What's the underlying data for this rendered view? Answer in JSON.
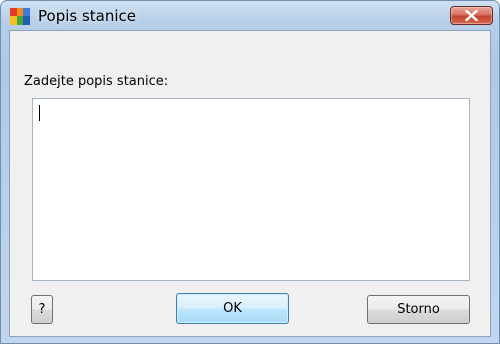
{
  "window": {
    "title": "Popis stanice",
    "app_icon": "avg-logo-icon",
    "close_icon": "close-icon"
  },
  "form": {
    "prompt_label": "Zadejte popis stanice:",
    "description_value": "",
    "description_placeholder": ""
  },
  "buttons": {
    "help_label": "?",
    "ok_label": "OK",
    "cancel_label": "Storno"
  },
  "colors": {
    "close_button": "#c4432f",
    "ok_button_border": "#3c7fb1"
  }
}
